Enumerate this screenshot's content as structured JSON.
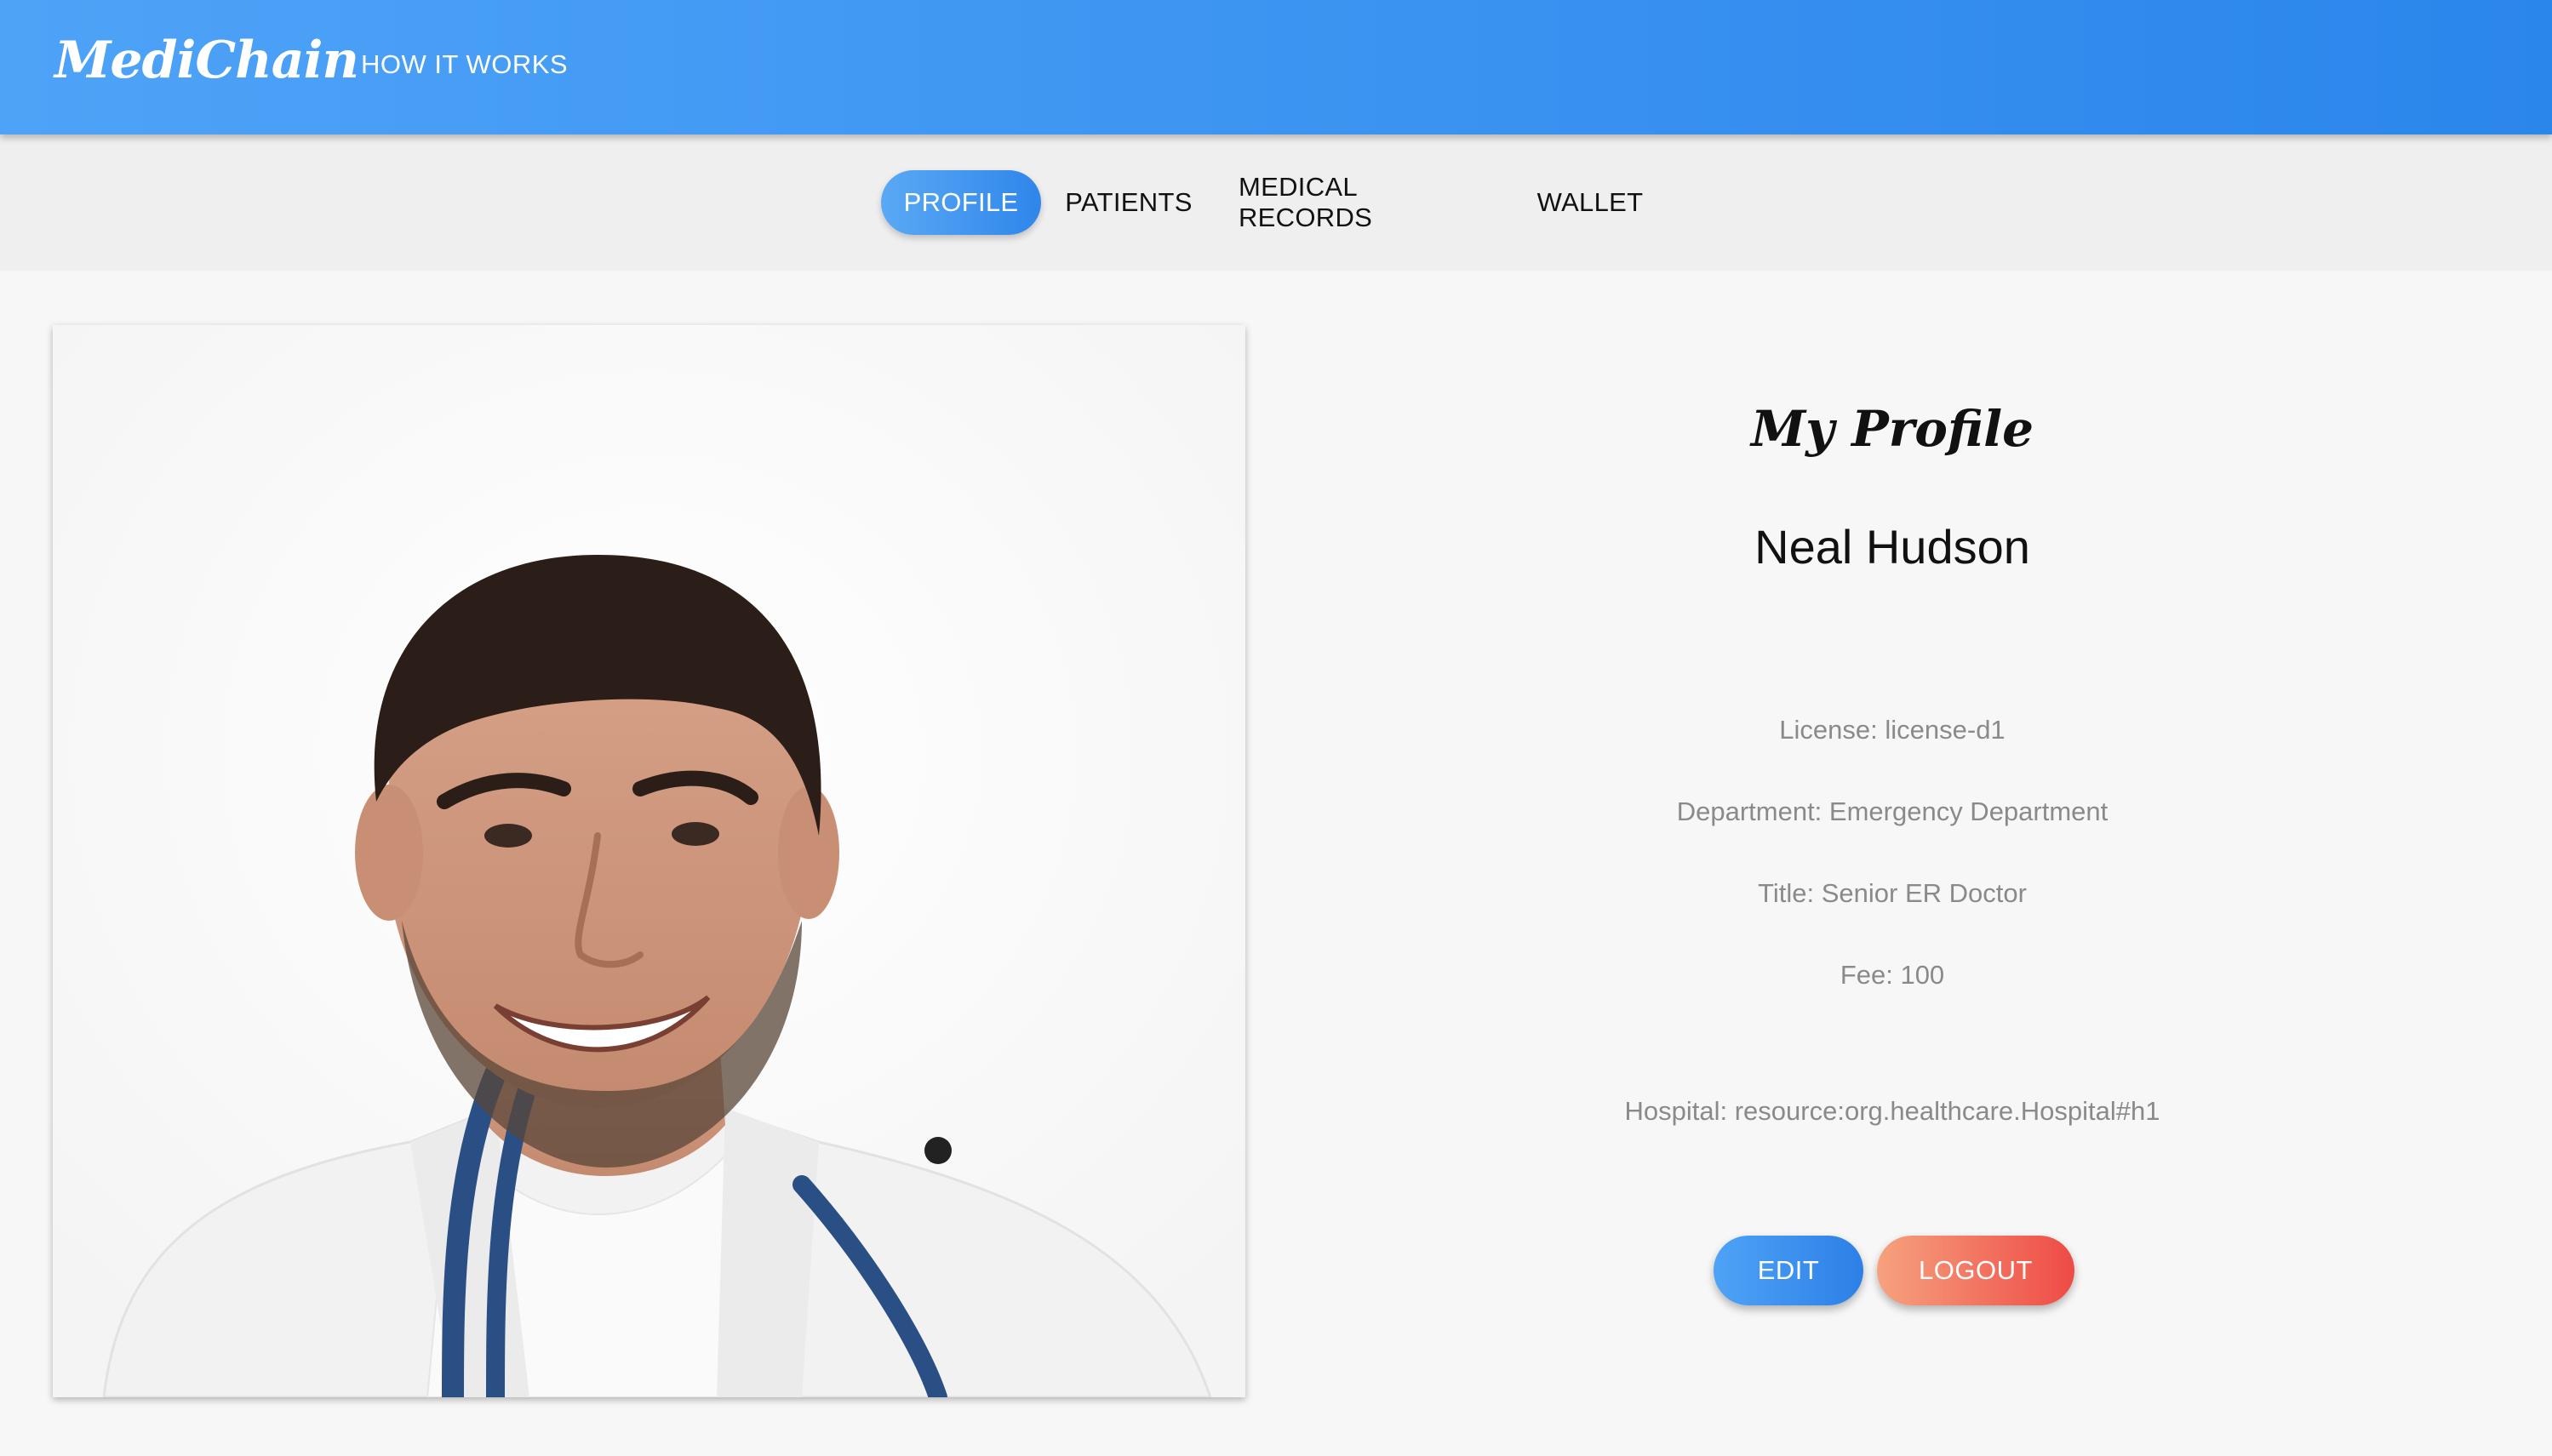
{
  "appbar": {
    "brand": "MediChain",
    "nav_link": "HOW IT WORKS"
  },
  "tabs": [
    {
      "label": "PROFILE",
      "active": true
    },
    {
      "label": "PATIENTS",
      "active": false
    },
    {
      "label": "MEDICAL RECORDS",
      "active": false
    },
    {
      "label": "WALLET",
      "active": false
    }
  ],
  "profile": {
    "heading": "My Profile",
    "name": "Neal Hudson",
    "license": "License: license-d1",
    "department": "Department: Emergency Department",
    "title": "Title: Senior ER Doctor",
    "fee": "Fee: 100",
    "hospital": "Hospital: resource:org.healthcare.Hospital#h1",
    "edit_label": "EDIT",
    "logout_label": "LOGOUT"
  },
  "colors": {
    "primary_blue": "#2b86ec",
    "light_blue": "#4ea3f7",
    "logout_orange": "#f6a27f",
    "logout_red": "#ee4b45"
  }
}
